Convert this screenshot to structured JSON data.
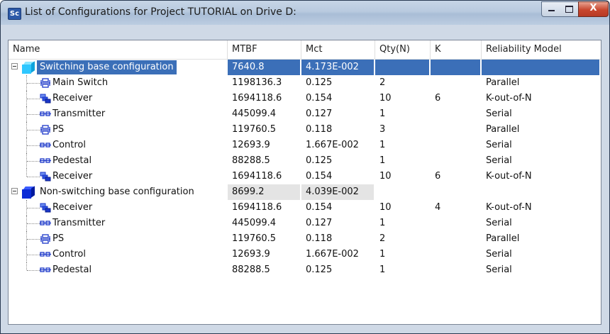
{
  "window": {
    "title": "List of Configurations for Project TUTORIAL on Drive D:",
    "app_icon": "Sc",
    "close_glyph": "X"
  },
  "columns": [
    "Name",
    "MTBF",
    "Mct",
    "Qty(N)",
    "K",
    "Reliability Model"
  ],
  "rows": [
    {
      "type": "config",
      "name": "Switching base configuration",
      "mtbf": "7640.8",
      "mct": "4.173E-002",
      "qty": "",
      "k": "",
      "model": "",
      "selected": true
    },
    {
      "type": "item",
      "icon": "parallel-icon",
      "name": "Main Switch",
      "mtbf": "1198136.3",
      "mct": "0.125",
      "qty": "2",
      "k": "",
      "model": "Parallel"
    },
    {
      "type": "item",
      "icon": "k-out-of-n-icon",
      "name": "Receiver",
      "mtbf": "1694118.6",
      "mct": "0.154",
      "qty": "10",
      "k": "6",
      "model": "K-out-of-N"
    },
    {
      "type": "item",
      "icon": "serial-icon",
      "name": "Transmitter",
      "mtbf": "445099.4",
      "mct": "0.127",
      "qty": "1",
      "k": "",
      "model": "Serial"
    },
    {
      "type": "item",
      "icon": "parallel-icon",
      "name": "PS",
      "mtbf": "119760.5",
      "mct": "0.118",
      "qty": "3",
      "k": "",
      "model": "Parallel"
    },
    {
      "type": "item",
      "icon": "serial-icon",
      "name": "Control",
      "mtbf": "12693.9",
      "mct": "1.667E-002",
      "qty": "1",
      "k": "",
      "model": "Serial"
    },
    {
      "type": "item",
      "icon": "serial-icon",
      "name": "Pedestal",
      "mtbf": "88288.5",
      "mct": "0.125",
      "qty": "1",
      "k": "",
      "model": "Serial"
    },
    {
      "type": "item",
      "icon": "k-out-of-n-icon",
      "name": "Receiver",
      "mtbf": "1694118.6",
      "mct": "0.154",
      "qty": "10",
      "k": "6",
      "model": "K-out-of-N"
    },
    {
      "type": "config",
      "name": "Non-switching base configuration",
      "mtbf": "8699.2",
      "mct": "4.039E-002",
      "qty": "",
      "k": "",
      "model": "",
      "selected": false
    },
    {
      "type": "item",
      "icon": "k-out-of-n-icon",
      "name": "Receiver",
      "mtbf": "1694118.6",
      "mct": "0.154",
      "qty": "10",
      "k": "4",
      "model": "K-out-of-N"
    },
    {
      "type": "item",
      "icon": "serial-icon",
      "name": "Transmitter",
      "mtbf": "445099.4",
      "mct": "0.127",
      "qty": "1",
      "k": "",
      "model": "Serial"
    },
    {
      "type": "item",
      "icon": "parallel-icon",
      "name": "PS",
      "mtbf": "119760.5",
      "mct": "0.118",
      "qty": "2",
      "k": "",
      "model": "Parallel"
    },
    {
      "type": "item",
      "icon": "serial-icon",
      "name": "Control",
      "mtbf": "12693.9",
      "mct": "1.667E-002",
      "qty": "1",
      "k": "",
      "model": "Serial"
    },
    {
      "type": "item",
      "icon": "serial-icon",
      "name": "Pedestal",
      "mtbf": "88288.5",
      "mct": "0.125",
      "qty": "1",
      "k": "",
      "model": "Serial"
    }
  ],
  "colors": {
    "selection": "#3b6fb8",
    "cube": "#0b2bd6",
    "cube_selected": "#2ec7ff",
    "icon": "#1a36c8"
  }
}
